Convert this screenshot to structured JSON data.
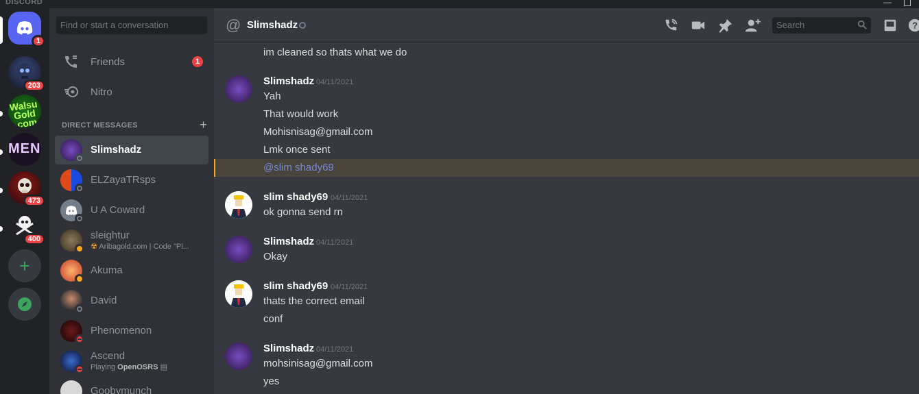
{
  "window": {
    "brand": "DISCORD",
    "minimize": "—"
  },
  "servers": [
    {
      "name": "Home",
      "badge": "1"
    },
    {
      "name": "server-1",
      "badge": "203"
    },
    {
      "name": "Walsu Gold",
      "badge": "",
      "label": "Walsu Gold .com"
    },
    {
      "name": "MENT",
      "badge": "",
      "label": "MENT"
    },
    {
      "name": "server-4",
      "badge": "473"
    },
    {
      "name": "server-5",
      "badge": "400"
    }
  ],
  "sidebar": {
    "search_placeholder": "Find or start a conversation",
    "friends_label": "Friends",
    "friends_badge": "1",
    "nitro_label": "Nitro",
    "dm_header": "DIRECT MESSAGES",
    "dm_plus": "+",
    "dms": [
      {
        "name": "Slimshadz",
        "status": "offline",
        "active": true
      },
      {
        "name": "ELZayaTRsps",
        "status": "offline"
      },
      {
        "name": "U A Coward",
        "status": "offline"
      },
      {
        "name": "sleightur",
        "status": "idle",
        "sub": "Aribagold.com | Code \"Pl..."
      },
      {
        "name": "Akuma",
        "status": "idle"
      },
      {
        "name": "David",
        "status": "offline"
      },
      {
        "name": "Phenomenon",
        "status": "dnd"
      },
      {
        "name": "Ascend",
        "status": "dnd",
        "sub_prefix": "Playing ",
        "sub_game": "OpenOSRS"
      },
      {
        "name": "Goobymunch",
        "status": "offline"
      }
    ]
  },
  "chat": {
    "header_title": "Slimshadz",
    "search_placeholder": "Search",
    "messages": [
      {
        "type": "continuation",
        "text": "im cleaned so thats what we do"
      },
      {
        "author": "Slimshadz",
        "timestamp": "04/11/2021",
        "lines": [
          "Yah",
          "That would work",
          "Mohisnisag@gmail.com",
          "Lmk once sent"
        ],
        "mention": "@slim shady69"
      },
      {
        "author": "slim shady69",
        "timestamp": "04/11/2021",
        "lines": [
          "ok gonna send rn"
        ]
      },
      {
        "author": "Slimshadz",
        "timestamp": "04/11/2021",
        "lines": [
          "Okay"
        ]
      },
      {
        "author": "slim shady69",
        "timestamp": "04/11/2021",
        "lines": [
          "thats the correct email",
          "conf"
        ]
      },
      {
        "author": "Slimshadz",
        "timestamp": "04/11/2021",
        "lines": [
          "mohsinisag@gmail.com",
          "yes"
        ]
      }
    ]
  },
  "icons": [
    "discord-logo-icon",
    "friends-icon",
    "nitro-icon",
    "add-dm-icon",
    "at-icon",
    "call-icon",
    "video-icon",
    "pin-icon",
    "add-member-icon",
    "search-icon",
    "inbox-icon",
    "help-icon",
    "add-server-icon",
    "explore-icon"
  ],
  "colors": {
    "blurple": "#5865f2",
    "red": "#ed4245",
    "green": "#3ba55d",
    "idle": "#faa81a",
    "mention": "#7289da"
  }
}
